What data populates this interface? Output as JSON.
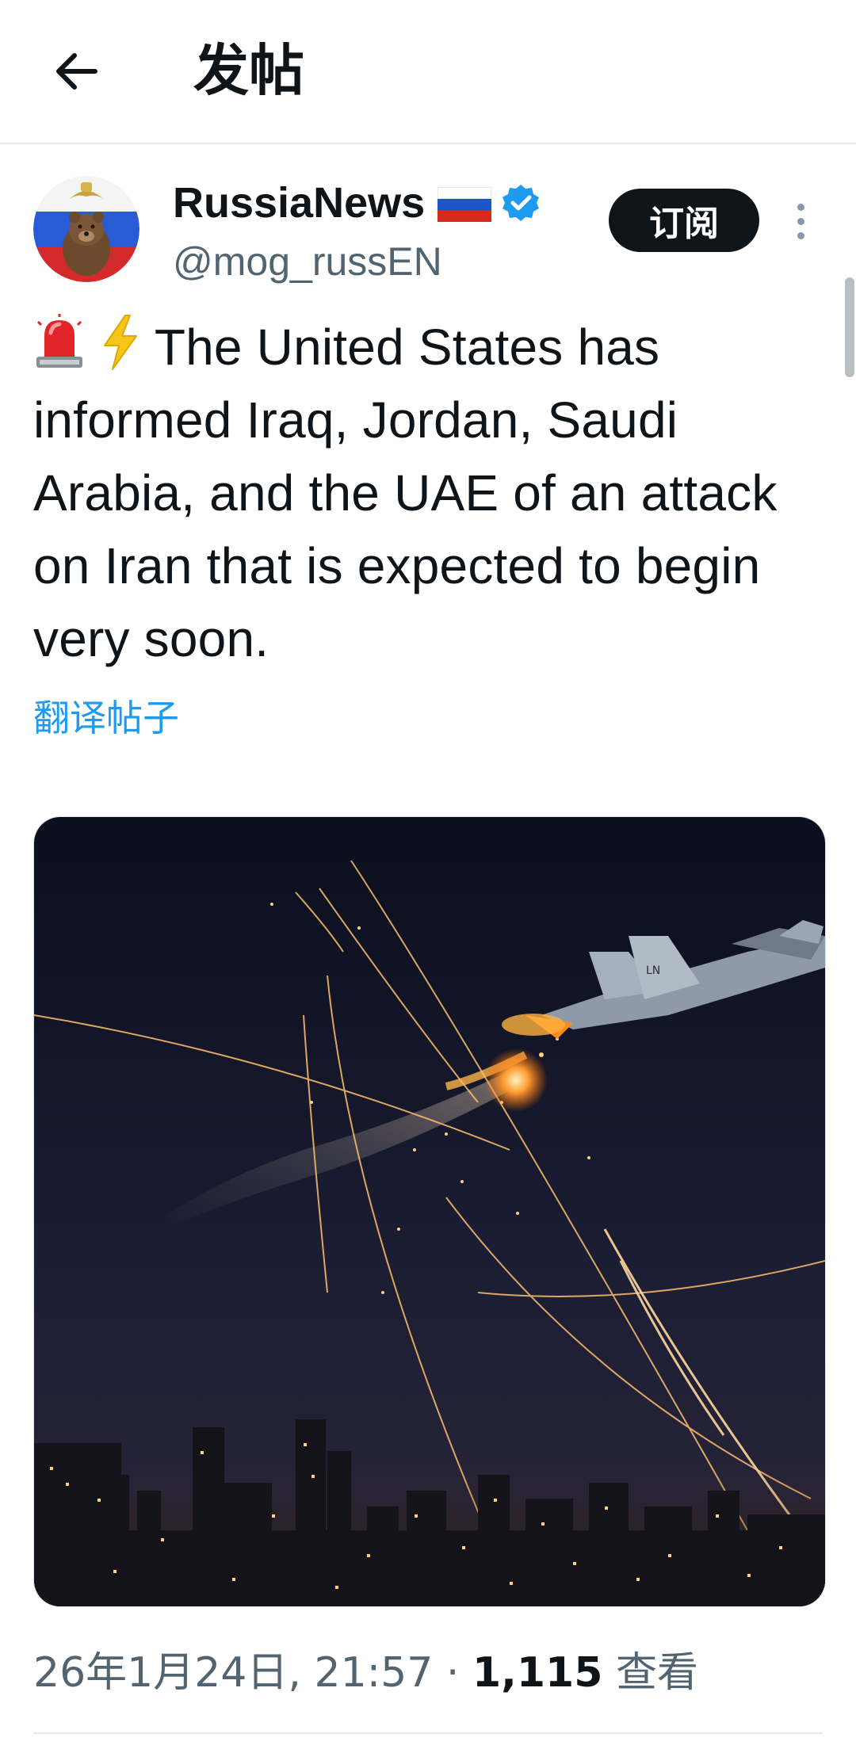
{
  "header": {
    "title": "发帖",
    "back_icon": "arrow-left-icon"
  },
  "author": {
    "name": "RussiaNews",
    "handle": "@mog_russEN",
    "flag_icon": "russia-flag-icon",
    "verified_icon": "verified-badge-icon",
    "verified_color": "#1d9bf0"
  },
  "actions": {
    "subscribe_label": "订阅",
    "more_icon": "more-vertical-icon"
  },
  "post": {
    "emoji_1": "siren-icon",
    "emoji_2": "lightning-icon",
    "text": "The United States has informed Iraq, Jordan, Saudi Arabia, and the UAE of an attack on Iran that is expected to begin very soon.",
    "translate_label": "翻译帖子"
  },
  "meta": {
    "timestamp": "26年1月24日, 21:57",
    "separator": " · ",
    "views_count": "1,115",
    "views_label": "查看"
  },
  "colors": {
    "accent": "#1d9bf0",
    "text_primary": "#0f1419",
    "text_secondary": "#536471"
  }
}
